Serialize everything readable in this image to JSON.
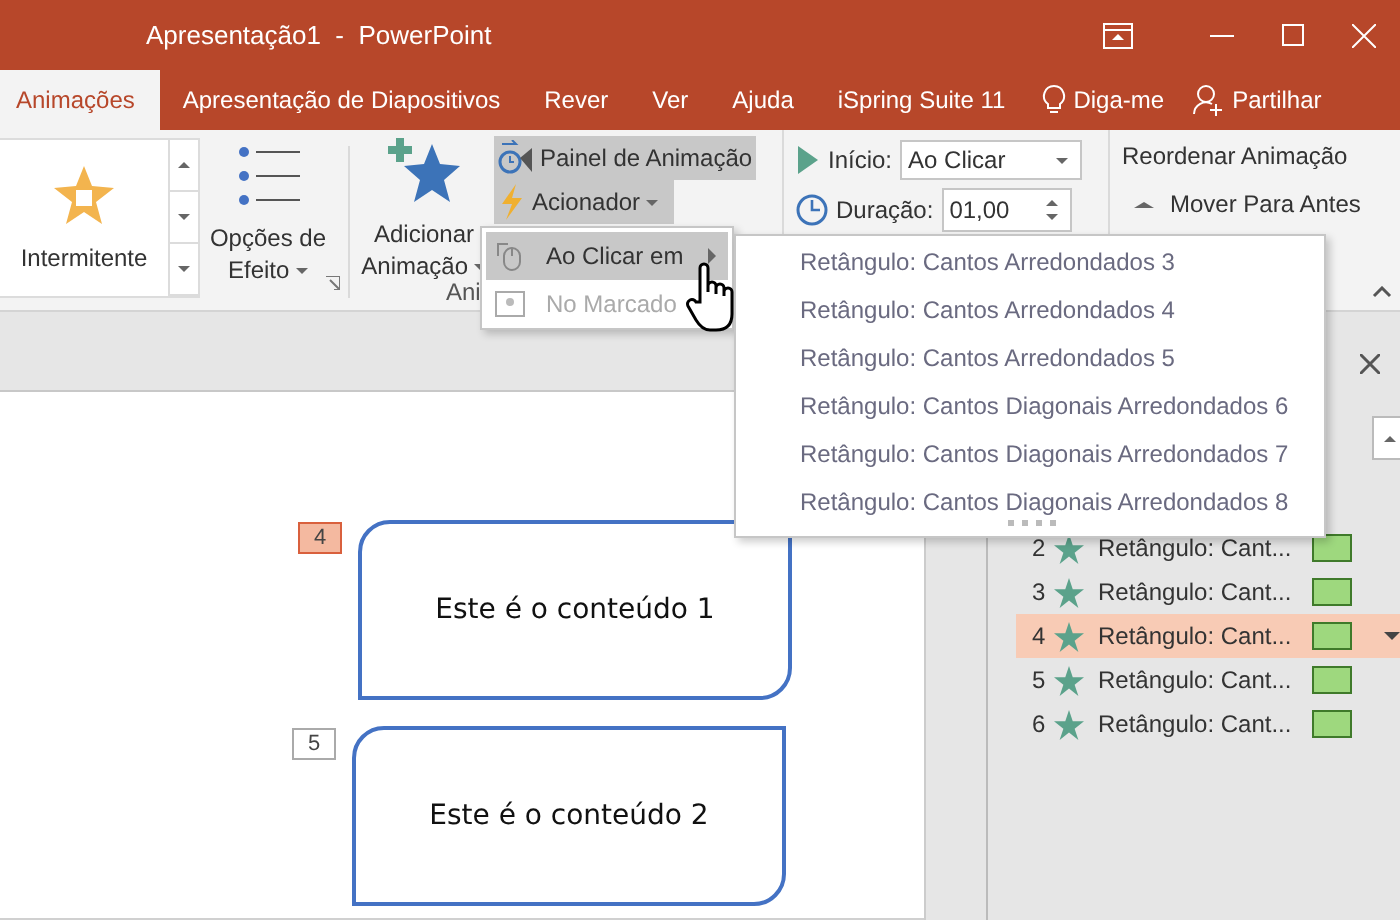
{
  "window": {
    "title": "Apresentação1  -  PowerPoint"
  },
  "tabs": [
    {
      "label": "Animações",
      "selected": true
    },
    {
      "label": "Apresentação de Diapositivos",
      "selected": false
    },
    {
      "label": "Rever",
      "selected": false
    },
    {
      "label": "Ver",
      "selected": false
    },
    {
      "label": "Ajuda",
      "selected": false
    },
    {
      "label": "iSpring Suite 11",
      "selected": false
    }
  ],
  "tell_me": "Diga-me",
  "share": "Partilhar",
  "ribbon": {
    "effect_gallery": {
      "item": "Intermitente"
    },
    "effect_options": {
      "line_1": "Opções de",
      "line_2": "Efeito"
    },
    "add_animation": {
      "line_1": "Adicionar",
      "line_2": "Animação"
    },
    "animation_pane_button": {
      "label": "Painel de Animação",
      "on": true
    },
    "trigger_button": {
      "label": "Acionador",
      "on": true
    },
    "group_label": "Ani",
    "start": {
      "label": "Início:",
      "value": "Ao Clicar"
    },
    "duration": {
      "label": "Duração:",
      "value": "01,00"
    },
    "reorder_title": "Reordenar Animação",
    "move_earlier": "Mover Para Antes"
  },
  "trigger_menu": [
    {
      "label": "Ao Clicar em",
      "selected": true,
      "disabled": false
    },
    {
      "label": "No Marcado",
      "selected": false,
      "disabled": true
    }
  ],
  "shape_submenu": [
    "Retângulo: Cantos Arredondados 3",
    "Retângulo: Cantos Arredondados 4",
    "Retângulo: Cantos Arredondados 5",
    "Retângulo: Cantos Diagonais Arredondados 6",
    "Retângulo: Cantos Diagonais Arredondados 7",
    "Retângulo: Cantos Diagonais Arredondados 8"
  ],
  "slide": {
    "shapes": [
      {
        "badge": "4",
        "selected": true,
        "text": "Este é o conteúdo 1"
      },
      {
        "badge": "5",
        "selected": false,
        "text": "Este é o conteúdo 2"
      }
    ]
  },
  "animation_pane": {
    "items": [
      {
        "number": "2",
        "label": "Retângulo: Cant...",
        "selected": false
      },
      {
        "number": "3",
        "label": "Retângulo: Cant...",
        "selected": false
      },
      {
        "number": "4",
        "label": "Retângulo: Cant...",
        "selected": true
      },
      {
        "number": "5",
        "label": "Retângulo: Cant...",
        "selected": false
      },
      {
        "number": "6",
        "label": "Retângulo: Cant...",
        "selected": false
      }
    ]
  }
}
